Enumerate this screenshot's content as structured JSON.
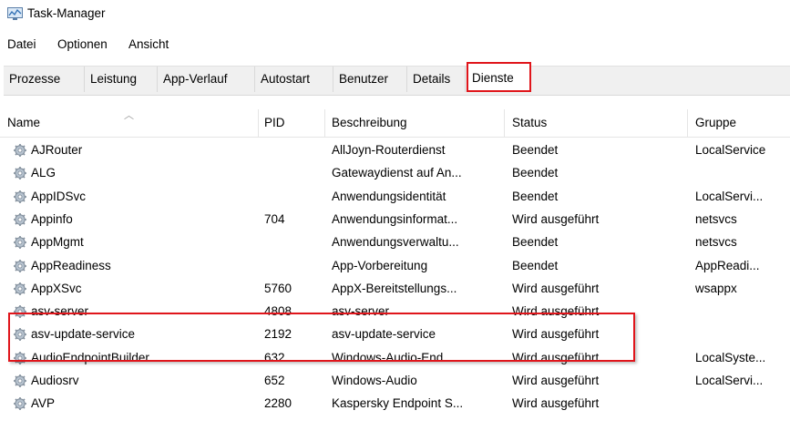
{
  "window": {
    "title": "Task-Manager"
  },
  "menu": [
    "Datei",
    "Optionen",
    "Ansicht"
  ],
  "tabs": [
    "Prozesse",
    "Leistung",
    "App-Verlauf",
    "Autostart",
    "Benutzer",
    "Details",
    "Dienste"
  ],
  "active_tab": "Dienste",
  "columns": [
    "Name",
    "PID",
    "Beschreibung",
    "Status",
    "Gruppe"
  ],
  "rows": [
    {
      "name": "AJRouter",
      "pid": "",
      "desc": "AllJoyn-Routerdienst",
      "status": "Beendet",
      "group": "LocalService"
    },
    {
      "name": "ALG",
      "pid": "",
      "desc": "Gatewaydienst auf An...",
      "status": "Beendet",
      "group": ""
    },
    {
      "name": "AppIDSvc",
      "pid": "",
      "desc": "Anwendungsidentität",
      "status": "Beendet",
      "group": "LocalServi..."
    },
    {
      "name": "Appinfo",
      "pid": "704",
      "desc": "Anwendungsinformat...",
      "status": "Wird ausgeführt",
      "group": "netsvcs"
    },
    {
      "name": "AppMgmt",
      "pid": "",
      "desc": "Anwendungsverwaltu...",
      "status": "Beendet",
      "group": "netsvcs"
    },
    {
      "name": "AppReadiness",
      "pid": "",
      "desc": "App-Vorbereitung",
      "status": "Beendet",
      "group": "AppReadi..."
    },
    {
      "name": "AppXSvc",
      "pid": "5760",
      "desc": "AppX-Bereitstellungs...",
      "status": "Wird ausgeführt",
      "group": "wsappx"
    },
    {
      "name": "asv-server",
      "pid": "4808",
      "desc": "asv-server",
      "status": "Wird ausgeführt",
      "group": ""
    },
    {
      "name": "asv-update-service",
      "pid": "2192",
      "desc": "asv-update-service",
      "status": "Wird ausgeführt",
      "group": ""
    },
    {
      "name": "AudioEndpointBuilder",
      "pid": "632",
      "desc": "Windows-Audio-End...",
      "status": "Wird ausgeführt",
      "group": "LocalSyste..."
    },
    {
      "name": "Audiosrv",
      "pid": "652",
      "desc": "Windows-Audio",
      "status": "Wird ausgeführt",
      "group": "LocalServi..."
    },
    {
      "name": "AVP",
      "pid": "2280",
      "desc": "Kaspersky Endpoint S...",
      "status": "Wird ausgeführt",
      "group": ""
    }
  ],
  "icons": {
    "app": "task-manager-icon",
    "service": "gear-icon"
  },
  "colors": {
    "highlight": "#e0151b"
  }
}
